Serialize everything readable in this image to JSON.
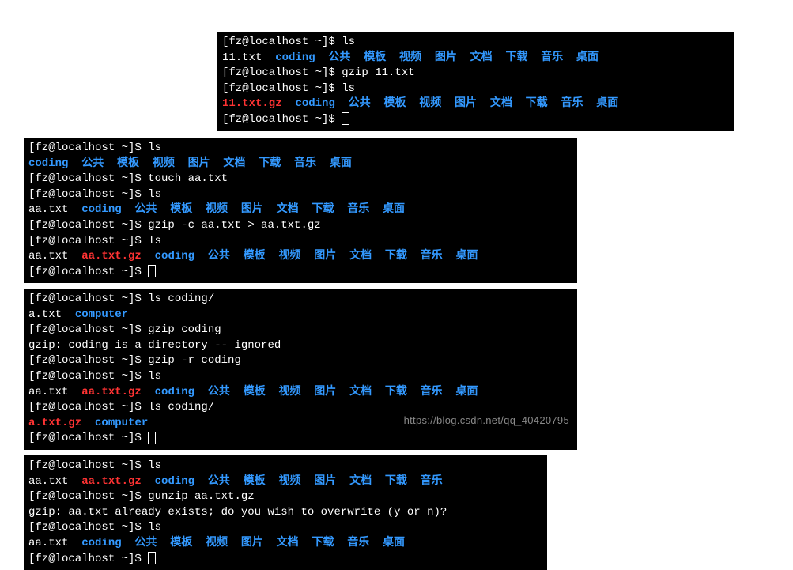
{
  "terminals": [
    {
      "id": "t1",
      "style": "left:275px; top:40px; width:654px;",
      "lines": [
        [
          {
            "t": "[fz@localhost ~]$ ls",
            "c": "white"
          }
        ],
        [
          {
            "t": "11.txt  ",
            "c": "white"
          },
          {
            "t": "coding  公共  模板  视频  图片  文档  下载  音乐  桌面",
            "c": "blue"
          }
        ],
        [
          {
            "t": "[fz@localhost ~]$ gzip 11.txt",
            "c": "white"
          }
        ],
        [
          {
            "t": "[fz@localhost ~]$ ls",
            "c": "white"
          }
        ],
        [
          {
            "t": "11.txt.gz",
            "c": "red"
          },
          {
            "t": "  ",
            "c": "white"
          },
          {
            "t": "coding  公共  模板  视频  图片  文档  下载  音乐  桌面",
            "c": "blue"
          }
        ],
        [
          {
            "t": "[fz@localhost ~]$ ",
            "c": "white"
          },
          {
            "cursor": true
          }
        ]
      ]
    },
    {
      "id": "t2",
      "style": "left:30px; top:174px; width:700px;",
      "lines": [
        [
          {
            "t": "[fz@localhost ~]$ ls",
            "c": "white"
          }
        ],
        [
          {
            "t": "coding  公共  模板  视频  图片  文档  下载  音乐  桌面",
            "c": "blue"
          }
        ],
        [
          {
            "t": "[fz@localhost ~]$ touch aa.txt",
            "c": "white"
          }
        ],
        [
          {
            "t": "[fz@localhost ~]$ ls",
            "c": "white"
          }
        ],
        [
          {
            "t": "aa.txt  ",
            "c": "white"
          },
          {
            "t": "coding  公共  模板  视频  图片  文档  下载  音乐  桌面",
            "c": "blue"
          }
        ],
        [
          {
            "t": "[fz@localhost ~]$ gzip -c aa.txt > aa.txt.gz",
            "c": "white"
          }
        ],
        [
          {
            "t": "[fz@localhost ~]$ ls",
            "c": "white"
          }
        ],
        [
          {
            "t": "aa.txt  ",
            "c": "white"
          },
          {
            "t": "aa.txt.gz",
            "c": "red"
          },
          {
            "t": "  ",
            "c": "white"
          },
          {
            "t": "coding  公共  模板  视频  图片  文档  下载  音乐  桌面",
            "c": "blue"
          }
        ],
        [
          {
            "t": "[fz@localhost ~]$ ",
            "c": "white"
          },
          {
            "cursor": true
          }
        ]
      ]
    },
    {
      "id": "t3",
      "style": "left:30px; top:365px; width:700px;",
      "watermark": "https://blog.csdn.net/qq_40420795",
      "lines": [
        [
          {
            "t": "[fz@localhost ~]$ ls coding/",
            "c": "white"
          }
        ],
        [
          {
            "t": "a.txt  ",
            "c": "white"
          },
          {
            "t": "computer",
            "c": "blue"
          }
        ],
        [
          {
            "t": "[fz@localhost ~]$ gzip coding",
            "c": "white"
          }
        ],
        [
          {
            "t": "gzip: coding is a directory -- ignored",
            "c": "white"
          }
        ],
        [
          {
            "t": "[fz@localhost ~]$ gzip -r coding",
            "c": "white"
          }
        ],
        [
          {
            "t": "[fz@localhost ~]$ ls",
            "c": "white"
          }
        ],
        [
          {
            "t": "aa.txt  ",
            "c": "white"
          },
          {
            "t": "aa.txt.gz",
            "c": "red"
          },
          {
            "t": "  ",
            "c": "white"
          },
          {
            "t": "coding  公共  模板  视频  图片  文档  下载  音乐  桌面",
            "c": "blue"
          }
        ],
        [
          {
            "t": "[fz@localhost ~]$ ls coding/",
            "c": "white"
          }
        ],
        [
          {
            "t": "a.txt.gz",
            "c": "red"
          },
          {
            "t": "  ",
            "c": "white"
          },
          {
            "t": "computer",
            "c": "blue"
          }
        ],
        [
          {
            "t": "[fz@localhost ~]$ ",
            "c": "white"
          },
          {
            "cursor": true
          }
        ]
      ]
    },
    {
      "id": "t4",
      "style": "left:30px; top:576px; width:662px;",
      "lines": [
        [
          {
            "t": "[fz@localhost ~]$ ls",
            "c": "white"
          }
        ],
        [
          {
            "t": "aa.txt  ",
            "c": "white"
          },
          {
            "t": "aa.txt.gz",
            "c": "red"
          },
          {
            "t": "  ",
            "c": "white"
          },
          {
            "t": "coding  公共  模板  视频  图片  文档  下载  音乐",
            "c": "blue"
          }
        ],
        [
          {
            "t": "[fz@localhost ~]$ gunzip aa.txt.gz",
            "c": "white"
          }
        ],
        [
          {
            "t": "gzip: aa.txt already exists; do you wish to overwrite (y or n)?",
            "c": "white"
          }
        ],
        [
          {
            "t": "[fz@localhost ~]$ ls",
            "c": "white"
          }
        ],
        [
          {
            "t": "aa.txt  ",
            "c": "white"
          },
          {
            "t": "coding  公共  模板  视频  图片  文档  下载  音乐  桌面",
            "c": "blue"
          }
        ],
        [
          {
            "t": "[fz@localhost ~]$ ",
            "c": "white"
          },
          {
            "cursor": true
          }
        ]
      ]
    }
  ]
}
